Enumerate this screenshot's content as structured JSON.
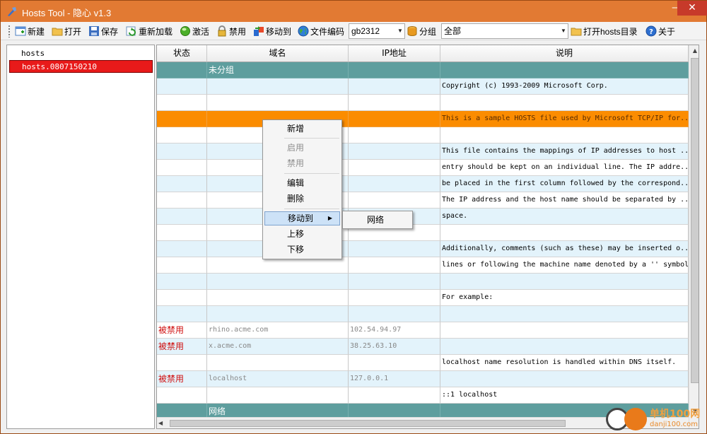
{
  "window": {
    "title": "Hosts Tool - 隐心 v1.3",
    "minimize": "—",
    "close": "✕"
  },
  "toolbar": {
    "new": "新建",
    "open": "打开",
    "save": "保存",
    "reload": "重新加载",
    "activate": "激活",
    "disable": "禁用",
    "move_to": "移动到",
    "encoding_label": "文件编码",
    "encoding_value": "gb2312",
    "group_label": "分组",
    "group_value": "全部",
    "open_hosts_dir": "打开hosts目录",
    "about": "关于"
  },
  "tree": {
    "items": [
      {
        "label": "hosts"
      },
      {
        "label": "hosts.0807150210"
      }
    ]
  },
  "table": {
    "headers": [
      "状态",
      "域名",
      "IP地址",
      "说明"
    ],
    "rows": [
      {
        "status": "",
        "domain": "未分组",
        "ip": "",
        "desc": ""
      },
      {
        "status": "",
        "domain": "",
        "ip": "",
        "desc": "Copyright (c) 1993-2009 Microsoft Corp."
      },
      {
        "status": "",
        "domain": "",
        "ip": "",
        "desc": ""
      },
      {
        "status": "",
        "domain": "",
        "ip": "",
        "desc": "This is a sample HOSTS file used by Microsoft TCP/IP for..."
      },
      {
        "status": "",
        "domain": "",
        "ip": "",
        "desc": ""
      },
      {
        "status": "",
        "domain": "",
        "ip": "",
        "desc": "This file contains the mappings of IP addresses to host ..."
      },
      {
        "status": "",
        "domain": "",
        "ip": "",
        "desc": "entry should be kept on an individual line. The IP addre..."
      },
      {
        "status": "",
        "domain": "",
        "ip": "",
        "desc": "be placed in the first column followed by the correspond..."
      },
      {
        "status": "",
        "domain": "",
        "ip": "",
        "desc": "The IP address and the host name should be separated by ..."
      },
      {
        "status": "",
        "domain": "",
        "ip": "",
        "desc": "space."
      },
      {
        "status": "",
        "domain": "",
        "ip": "",
        "desc": ""
      },
      {
        "status": "",
        "domain": "",
        "ip": "",
        "desc": "Additionally, comments (such as these) may be inserted o..."
      },
      {
        "status": "",
        "domain": "",
        "ip": "",
        "desc": "lines or following the machine name denoted by a '' symbol"
      },
      {
        "status": "",
        "domain": "",
        "ip": "",
        "desc": ""
      },
      {
        "status": "",
        "domain": "",
        "ip": "",
        "desc": "For example:"
      },
      {
        "status": "",
        "domain": "",
        "ip": "",
        "desc": ""
      },
      {
        "status": "被禁用",
        "domain": "rhino.acme.com",
        "ip": "102.54.94.97",
        "desc": ""
      },
      {
        "status": "被禁用",
        "domain": "x.acme.com",
        "ip": "38.25.63.10",
        "desc": ""
      },
      {
        "status": "",
        "domain": "",
        "ip": "",
        "desc": "localhost name resolution is handled within DNS itself."
      },
      {
        "status": "被禁用",
        "domain": "localhost",
        "ip": "127.0.0.1",
        "desc": ""
      },
      {
        "status": "",
        "domain": "",
        "ip": "",
        "desc": "::1 localhost"
      },
      {
        "status": "",
        "domain": "网络",
        "ip": "",
        "desc": ""
      }
    ]
  },
  "context_menu": {
    "items": [
      "新增",
      "启用",
      "禁用",
      "编辑",
      "删除",
      "移动到",
      "上移",
      "下移"
    ],
    "submenu": [
      "网络"
    ]
  },
  "watermark": {
    "line1": "单机100网",
    "line2": "danji100.com"
  },
  "colors": {
    "titlebar": "#e27a33",
    "group_row": "#5e9e9e",
    "selected_row": "#fb8c00",
    "alt_row": "#e3f3fb",
    "disabled_text": "#d01010",
    "tree_selected": "#e81a1a"
  }
}
